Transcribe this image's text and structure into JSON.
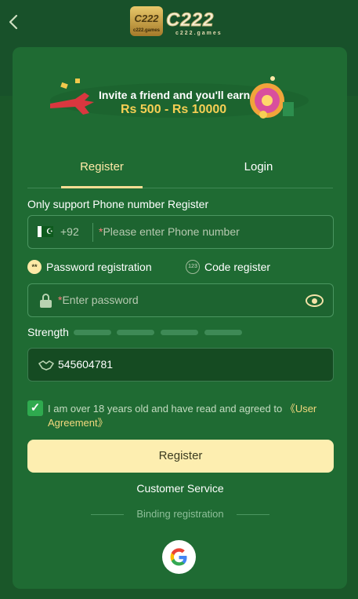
{
  "header": {
    "back_icon": "chevron-left-icon",
    "logo_badge": "C222",
    "logo_badge_sub": "c222.games",
    "logo_word": "C222",
    "logo_word_sub": "c222.games"
  },
  "banner": {
    "line1": "Invite a friend and you'll earn",
    "line2": "Rs 500 - Rs 10000"
  },
  "tabs": [
    {
      "label": "Register",
      "active": true
    },
    {
      "label": "Login",
      "active": false
    }
  ],
  "form": {
    "note": "Only support Phone number Register",
    "country_code": "+92",
    "phone_placeholder": "Please enter Phone number",
    "required_mark": "*",
    "modes": [
      {
        "label": "Password registration",
        "icon": "**",
        "selected": true
      },
      {
        "label": "Code register",
        "icon": "123",
        "selected": false
      }
    ],
    "password_placeholder": "Enter password",
    "strength_label": "Strength",
    "invite_code": "545604781",
    "agree_text": "I am over 18 years old and have read and agreed to ",
    "agree_link": "《User Agreement》",
    "submit_label": "Register"
  },
  "footer": {
    "customer_service": "Customer Service",
    "binding_label": "Binding registration"
  },
  "colors": {
    "background": "#1b5a2a",
    "card": "#1f6b33",
    "accent": "#fdeeb0",
    "checkbox": "#2faa4f"
  }
}
